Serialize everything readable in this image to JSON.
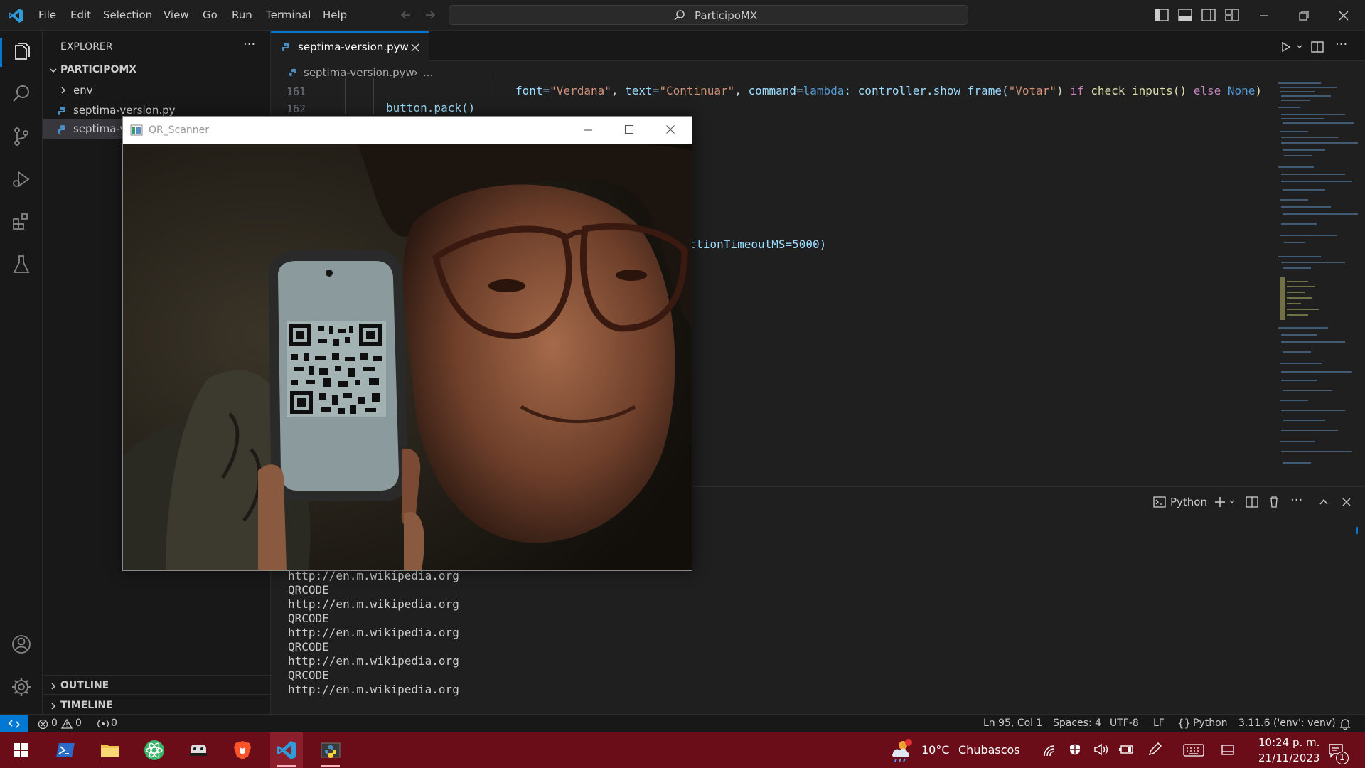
{
  "titlebar": {
    "menus": [
      "File",
      "Edit",
      "Selection",
      "View",
      "Go",
      "Run",
      "Terminal",
      "Help"
    ],
    "search_text": "ParticipoMX"
  },
  "sidebar": {
    "header": "EXPLORER",
    "more": "···",
    "folder": "PARTICIPOMX",
    "items": [
      {
        "label": "env"
      },
      {
        "label": "septima-version.py"
      },
      {
        "label": "septima-v"
      }
    ],
    "outline": "OUTLINE",
    "timeline": "TIMELINE"
  },
  "editor": {
    "tab_label": "septima-version.pyw",
    "breadcrumb_file": "septima-version.pyw",
    "breadcrumb_more": "...",
    "lines": [
      {
        "num": "161",
        "kw_font": "font=",
        "s1": "\"Verdana\"",
        "c1": ", ",
        "kw_text": "text=",
        "s2": "\"Continuar\"",
        "c2": ", ",
        "kw_cmd": "command=",
        "lambda": "lambda",
        "c3": ": controller.show_frame(",
        "s3": "\"Votar\"",
        "c4": ") ",
        "kw_if": "if",
        "c5": " check_inputs() ",
        "kw_else": "else",
        "c6": " ",
        "none": "None",
        "c7": ")"
      },
      {
        "num": "162",
        "text": "button.pack()"
      }
    ],
    "partial_line": "ectionTimeoutMS=5000)"
  },
  "panel": {
    "shell": "Python",
    "output": [
      "http://en.m.wikipedia.org",
      "QRCODE",
      "http://en.m.wikipedia.org",
      "QRCODE",
      "http://en.m.wikipedia.org",
      "QRCODE",
      "http://en.m.wikipedia.org",
      "QRCODE",
      "http://en.m.wikipedia.org"
    ]
  },
  "statusbar": {
    "errors": "0",
    "warnings": "0",
    "ports": "0",
    "position": "Ln 95, Col 1",
    "spaces": "Spaces: 4",
    "encoding": "UTF-8",
    "eol": "LF",
    "language": "Python",
    "interpreter": "3.11.6 ('env': venv)"
  },
  "qr_window": {
    "title": "QR_Scanner"
  },
  "taskbar": {
    "weather_temp": "10°C",
    "weather_desc": "Chubascos",
    "time": "10:24 p. m.",
    "date": "21/11/2023",
    "notif_count": "1"
  },
  "colors": {
    "accent": "#0078d4",
    "taskbar": "#6a0d19",
    "string": "#ce9178",
    "keyword": "#569cd6",
    "control": "#c586c0",
    "function": "#dcdcaa"
  }
}
